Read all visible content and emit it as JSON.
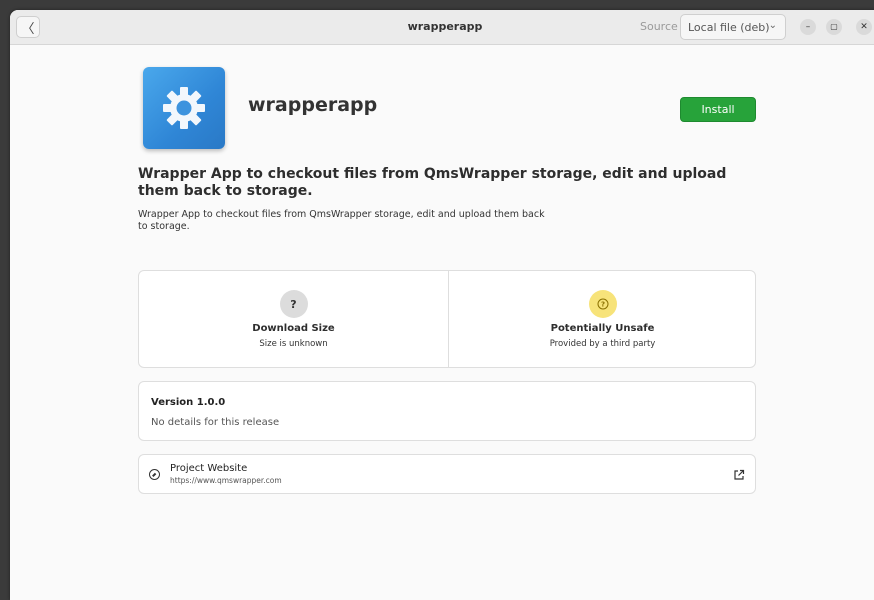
{
  "window": {
    "title": "wrapperapp",
    "back_label": "〈",
    "source_label": "Source",
    "source_value": "Local file (deb)",
    "controls": {
      "minimize": "–",
      "maximize": "▢",
      "close": "✕"
    }
  },
  "app": {
    "name": "wrapperapp",
    "icon": "gear-icon",
    "install_label": "Install",
    "headline": "Wrapper App to checkout files from QmsWrapper storage, edit and upload them back to storage.",
    "description": "Wrapper App to checkout files from QmsWrapper storage, edit and upload them back\n to storage."
  },
  "info": {
    "download": {
      "glyph": "?",
      "title": "Download Size",
      "subtitle": "Size is unknown"
    },
    "safety": {
      "glyph": "?",
      "title": "Potentially Unsafe",
      "subtitle": "Provided by a third party"
    }
  },
  "version": {
    "title": "Version 1.0.0",
    "details": "No details for this release"
  },
  "website": {
    "title": "Project Website",
    "url": "https://www.qmswrapper.com"
  },
  "colors": {
    "install": "#27a33a",
    "icon_blue": "#3b95e0",
    "warning": "#f7e37a"
  }
}
